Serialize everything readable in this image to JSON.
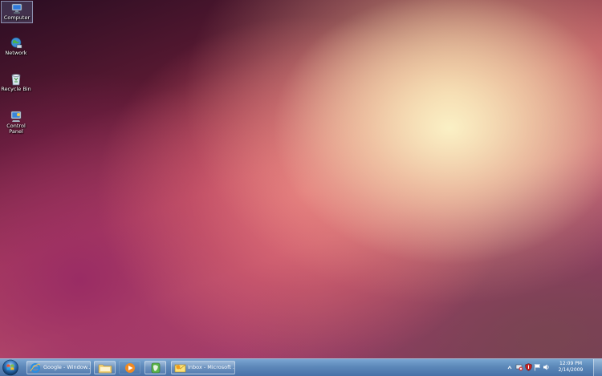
{
  "desktop_icons": [
    {
      "label": "Computer",
      "icon": "computer-icon",
      "selected": true
    },
    {
      "label": "Network",
      "icon": "network-icon"
    },
    {
      "label": "Recycle Bin",
      "icon": "recycle-bin-icon"
    },
    {
      "label_line1": "Control",
      "label_line2": "Panel",
      "icon": "control-panel-icon"
    }
  ],
  "taskbar": {
    "start_icon": "windows-logo-icon",
    "buttons": [
      {
        "label": "Google - Window...",
        "icon": "internet-explorer-icon"
      },
      {
        "label": "",
        "icon": "folder-icon"
      },
      {
        "label": "",
        "icon": "media-player-icon"
      },
      {
        "label": "",
        "icon": "evernote-icon"
      },
      {
        "label": "Inbox - Microsoft ...",
        "icon": "outlook-icon"
      }
    ],
    "tray": {
      "icons": [
        "show-hidden-icons-icon",
        "network-warning-icon",
        "security-icon",
        "flag-icon",
        "volume-icon"
      ],
      "time": "12:09 PM",
      "date": "2/14/2009"
    }
  },
  "colors": {
    "taskbar": "#5e8fc2",
    "wallpaper_light": "#f5e6a8",
    "wallpaper_mid": "#c25a6d",
    "wallpaper_dark": "#2a0d22"
  }
}
